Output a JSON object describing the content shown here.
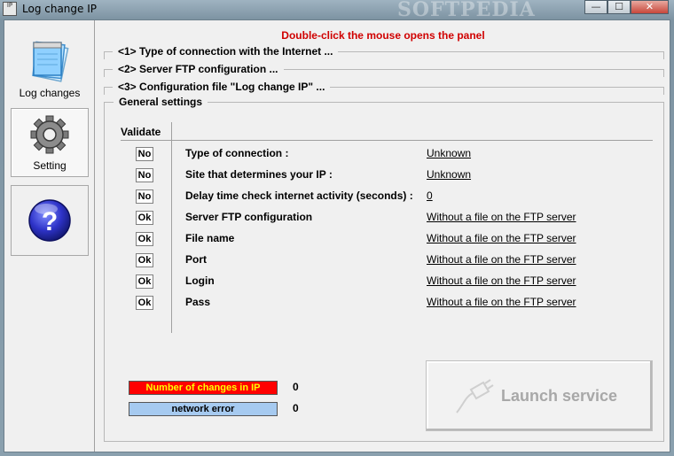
{
  "window": {
    "title": "Log change IP",
    "watermark": "SOFTPEDIA",
    "icon_text": "IP",
    "controls": {
      "minimize": "—",
      "maximize": "☐",
      "close": "✕"
    }
  },
  "sidebar": {
    "items": [
      {
        "label": "Log changes",
        "icon": "notepad-icon"
      },
      {
        "label": "Setting",
        "icon": "gear-icon"
      },
      {
        "label": "",
        "icon": "help-icon",
        "glyph": "?"
      }
    ]
  },
  "main": {
    "banner": "Double-click the mouse opens the panel",
    "sections": [
      "<1>  Type of connection with the Internet  ...",
      "<2>  Server FTP configuration  ...",
      "<3>  Configuration file \"Log change IP\"  ..."
    ],
    "general": {
      "caption": "General settings",
      "validate_header": "Validate",
      "rows": [
        {
          "status": "No",
          "label": "Type of connection :",
          "value": "Unknown"
        },
        {
          "status": "No",
          "label": "Site that determines your IP :",
          "value": "Unknown"
        },
        {
          "status": "No",
          "label": "Delay time check internet activity (seconds) :",
          "value": "0"
        },
        {
          "status": "Ok",
          "label": "Server FTP configuration",
          "value": "Without a file on the FTP server"
        },
        {
          "status": "Ok",
          "label": "File name",
          "value": "Without a file on the FTP server"
        },
        {
          "status": "Ok",
          "label": "Port",
          "value": "Without a file on the FTP server"
        },
        {
          "status": "Ok",
          "label": "Login",
          "value": "Without a file on the FTP server"
        },
        {
          "status": "Ok",
          "label": "Pass",
          "value": "Without a file on the FTP server"
        }
      ],
      "changes": {
        "label": "Number of changes in IP",
        "value": "0",
        "bg": "#ff0000",
        "fg": "#ffff00"
      },
      "network_error": {
        "label": "network error",
        "value": "0",
        "bg": "#a6caf0",
        "fg": "#000000"
      },
      "launch_label": "Launch service"
    }
  }
}
